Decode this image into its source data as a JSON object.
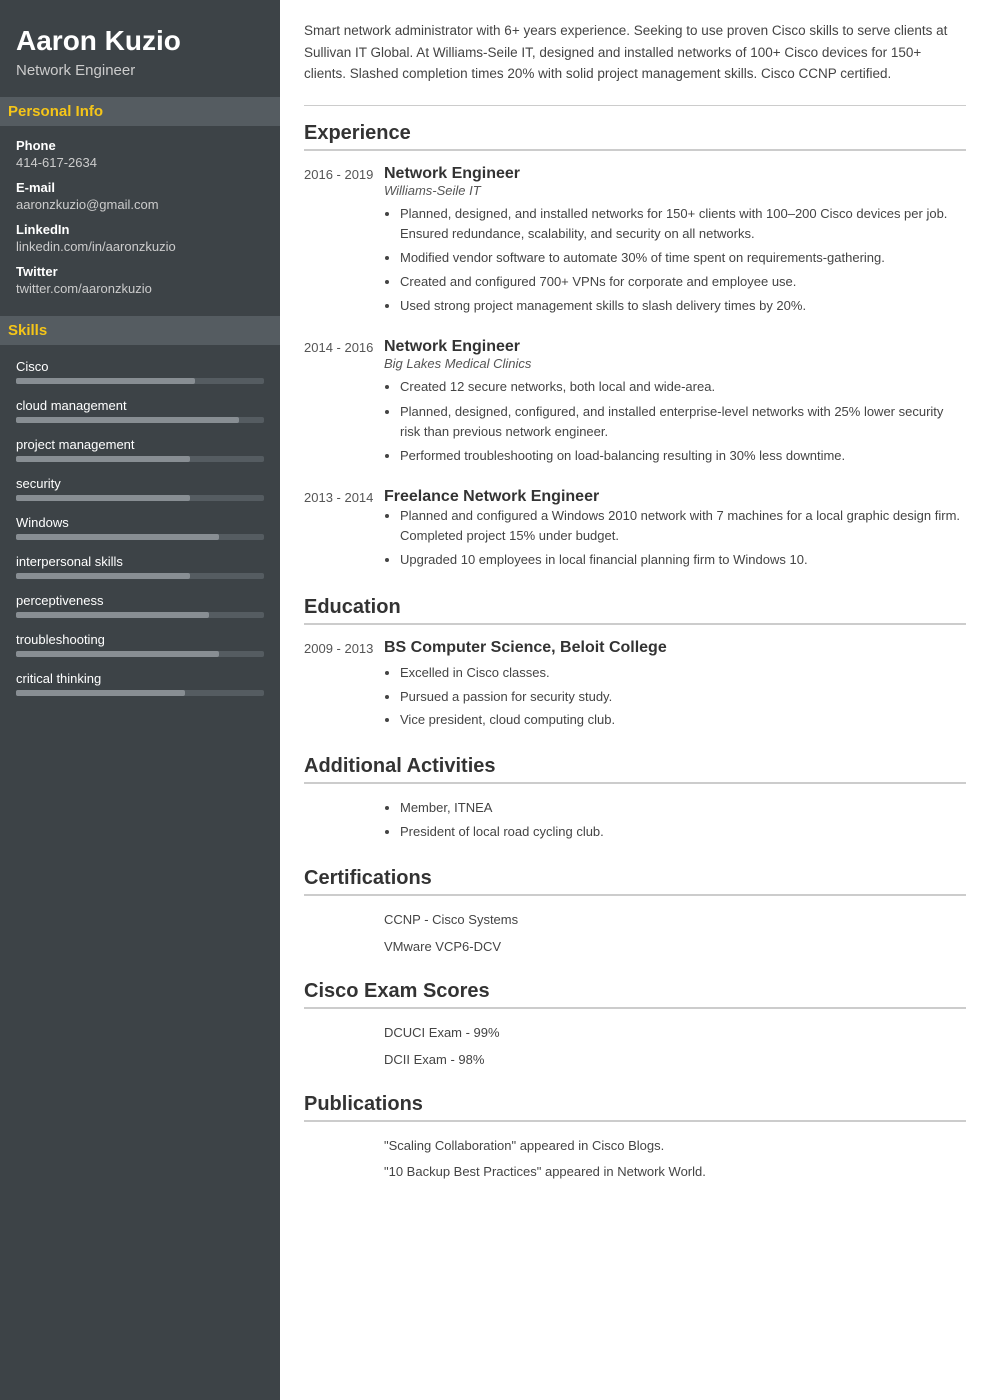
{
  "sidebar": {
    "name": "Aaron Kuzio",
    "job_title": "Network Engineer",
    "personal_info_label": "Personal Info",
    "phone_label": "Phone",
    "phone": "414-617-2634",
    "email_label": "E-mail",
    "email": "aaronzkuzio@gmail.com",
    "linkedin_label": "LinkedIn",
    "linkedin": "linkedin.com/in/aaronzkuzio",
    "twitter_label": "Twitter",
    "twitter": "twitter.com/aaronzkuzio",
    "skills_label": "Skills",
    "skills": [
      {
        "name": "Cisco",
        "pct": 72
      },
      {
        "name": "cloud management",
        "pct": 90
      },
      {
        "name": "project management",
        "pct": 70
      },
      {
        "name": "security",
        "pct": 70
      },
      {
        "name": "Windows",
        "pct": 82
      },
      {
        "name": "interpersonal skills",
        "pct": 70
      },
      {
        "name": "perceptiveness",
        "pct": 78
      },
      {
        "name": "troubleshooting",
        "pct": 82
      },
      {
        "name": "critical thinking",
        "pct": 68
      }
    ]
  },
  "main": {
    "summary": "Smart network administrator with 6+ years experience. Seeking to use proven Cisco skills to serve clients at Sullivan IT Global. At Williams-Seile IT, designed and installed networks of 100+ Cisco devices for 150+ clients. Slashed completion times 20% with solid project management skills. Cisco CCNP certified.",
    "experience_title": "Experience",
    "experience": [
      {
        "dates": "2016 - 2019",
        "job_title": "Network Engineer",
        "company": "Williams-Seile IT",
        "bullets": [
          "Planned, designed, and installed networks for 150+ clients with 100–200 Cisco devices per job. Ensured redundance, scalability, and security on all networks.",
          "Modified vendor software to automate 30% of time spent on requirements-gathering.",
          "Created and configured 700+ VPNs for corporate and employee use.",
          "Used strong project management skills to slash delivery times by 20%."
        ]
      },
      {
        "dates": "2014 - 2016",
        "job_title": "Network Engineer",
        "company": "Big Lakes Medical Clinics",
        "bullets": [
          "Created 12 secure networks, both local and wide-area.",
          "Planned, designed, configured, and installed enterprise-level networks with 25% lower security risk than previous network engineer.",
          "Performed troubleshooting on load-balancing resulting in 30% less downtime."
        ]
      },
      {
        "dates": "2013 - 2014",
        "job_title": "Freelance Network Engineer",
        "company": "",
        "bullets": [
          "Planned and configured a Windows 2010 network with 7 machines for a local graphic design firm. Completed project 15% under budget.",
          "Upgraded 10 employees in local financial planning firm to Windows 10."
        ]
      }
    ],
    "education_title": "Education",
    "education": [
      {
        "dates": "2009 - 2013",
        "edu_title": "BS Computer Science, Beloit College",
        "bullets": [
          "Excelled in Cisco classes.",
          "Pursued a passion for security study.",
          "Vice president, cloud computing club."
        ]
      }
    ],
    "activities_title": "Additional Activities",
    "activities": [
      "Member, ITNEA",
      "President of local road cycling club."
    ],
    "certifications_title": "Certifications",
    "certifications": [
      "CCNP - Cisco Systems",
      "VMware VCP6-DCV"
    ],
    "exam_scores_title": "Cisco Exam Scores",
    "exam_scores": [
      "DCUCI Exam - 99%",
      "DCII Exam - 98%"
    ],
    "publications_title": "Publications",
    "publications": [
      "\"Scaling Collaboration\" appeared in Cisco Blogs.",
      "\"10 Backup Best Practices\" appeared in Network World."
    ]
  }
}
